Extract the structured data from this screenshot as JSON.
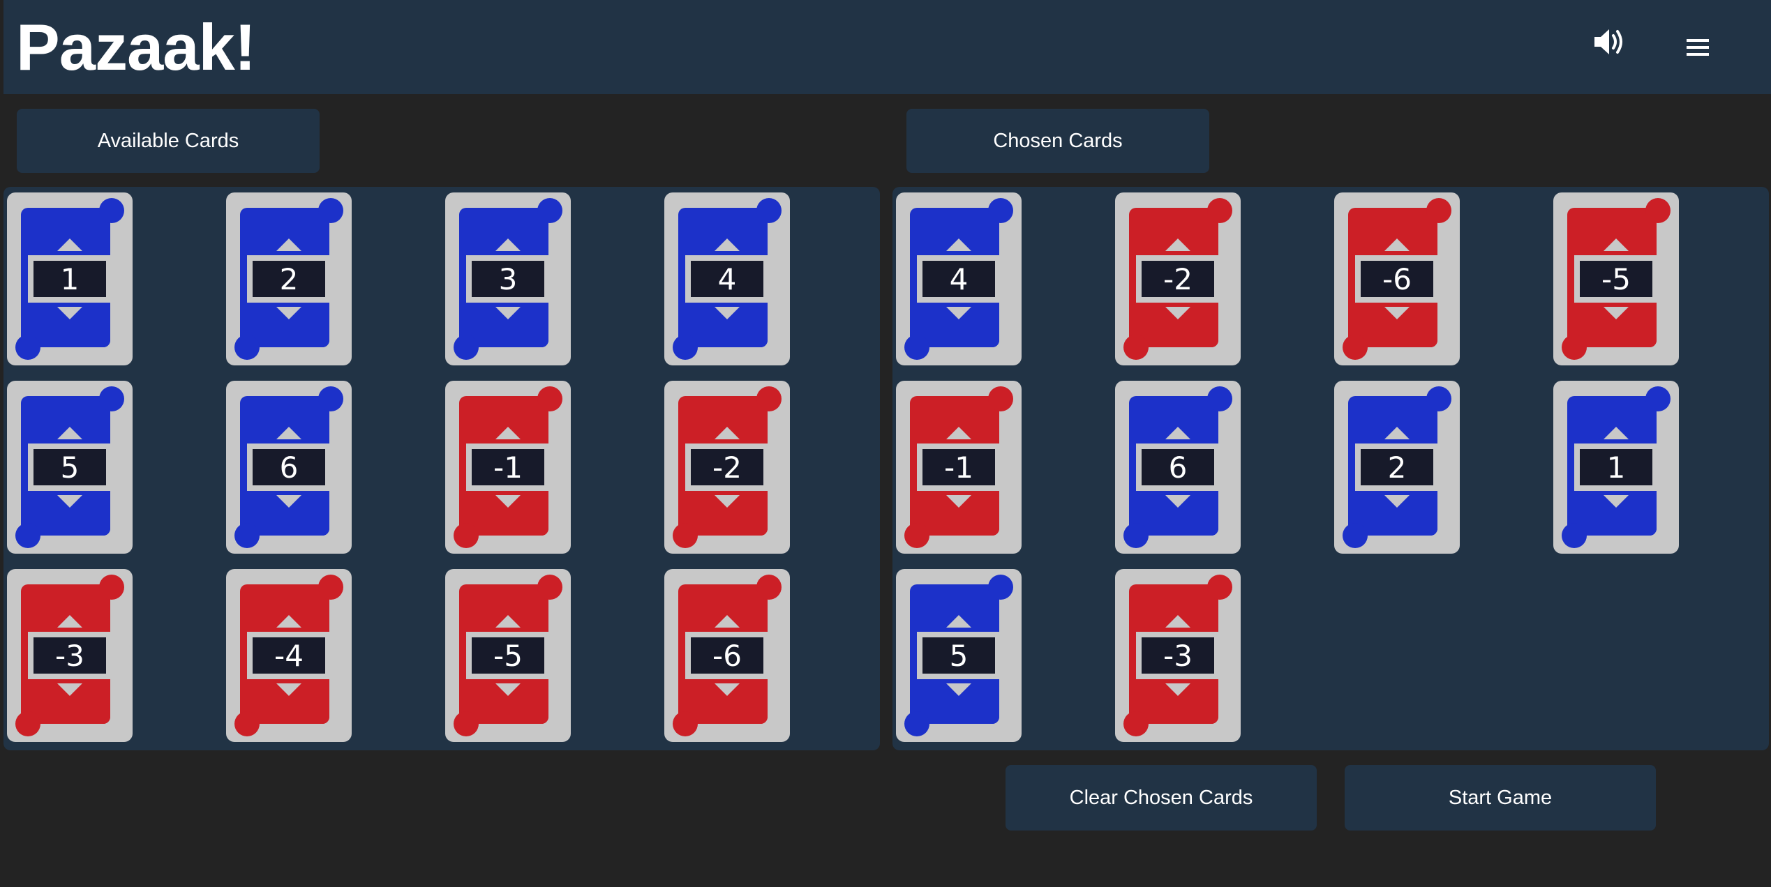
{
  "app": {
    "title": "Pazaak!",
    "sound_icon": "speaker-volume-icon",
    "menu_icon": "hamburger-menu-icon"
  },
  "colors": {
    "background": "#232323",
    "panel": "#213345",
    "card_border": "#c8c8c8",
    "card_blue": "#1c31c9",
    "card_red": "#cc1f26",
    "value_box": "#171a2a",
    "text": "#ffffff"
  },
  "available": {
    "label": "Available Cards",
    "cards": [
      {
        "value": "1",
        "color": "blue"
      },
      {
        "value": "2",
        "color": "blue"
      },
      {
        "value": "3",
        "color": "blue"
      },
      {
        "value": "4",
        "color": "blue"
      },
      {
        "value": "5",
        "color": "blue"
      },
      {
        "value": "6",
        "color": "blue"
      },
      {
        "value": "-1",
        "color": "red"
      },
      {
        "value": "-2",
        "color": "red"
      },
      {
        "value": "-3",
        "color": "red"
      },
      {
        "value": "-4",
        "color": "red"
      },
      {
        "value": "-5",
        "color": "red"
      },
      {
        "value": "-6",
        "color": "red"
      }
    ]
  },
  "chosen": {
    "label": "Chosen Cards",
    "cards": [
      {
        "value": "4",
        "color": "blue"
      },
      {
        "value": "-2",
        "color": "red"
      },
      {
        "value": "-6",
        "color": "red"
      },
      {
        "value": "-5",
        "color": "red"
      },
      {
        "value": "-1",
        "color": "red"
      },
      {
        "value": "6",
        "color": "blue"
      },
      {
        "value": "2",
        "color": "blue"
      },
      {
        "value": "1",
        "color": "blue"
      },
      {
        "value": "5",
        "color": "blue"
      },
      {
        "value": "-3",
        "color": "red"
      }
    ]
  },
  "actions": {
    "clear_label": "Clear Chosen Cards",
    "start_label": "Start Game"
  }
}
